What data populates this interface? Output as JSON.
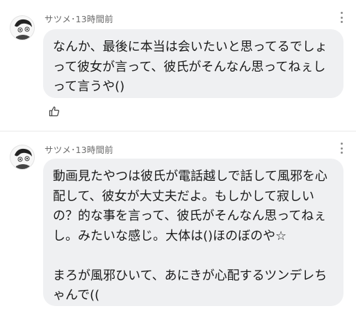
{
  "comments": [
    {
      "author": "サツメ",
      "separator": "･",
      "time": "13時間前",
      "text": "なんか、最後に本当は会いたいと思ってるでしょって彼女が言って、彼氏がそんなん思ってねぇしって言うや()"
    },
    {
      "author": "サツメ",
      "separator": "･",
      "time": "13時間前",
      "text": "動画見たやつは彼氏が電話越しで話して風邪を心配して、彼女が大丈夫だよ。もしかして寂しいの？的な事を言って、彼氏がそんなん思ってねぇし。みたいな感じ。大体は()ほのぼのや☆\n\nまろが風邪ひいて、あにきが心配するツンデレちゃんで(("
    }
  ],
  "icons": {
    "more": "more-vertical-icon",
    "like": "thumbs-up-icon",
    "avatar": "user-avatar"
  }
}
